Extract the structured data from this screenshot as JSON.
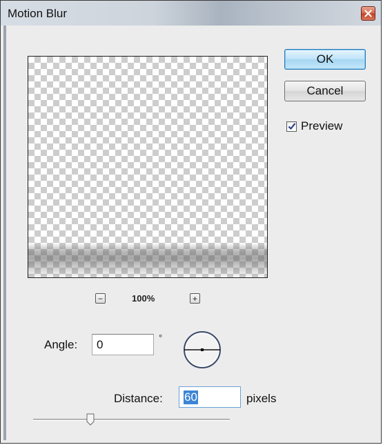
{
  "window": {
    "title": "Motion Blur"
  },
  "buttons": {
    "ok_label": "OK",
    "cancel_label": "Cancel"
  },
  "preview": {
    "checkbox_label": "Preview",
    "checked": true
  },
  "zoom": {
    "level": "100%",
    "zoom_out_symbol": "−",
    "zoom_in_symbol": "+"
  },
  "angle": {
    "label": "Angle:",
    "value": "0",
    "unit_symbol": "°"
  },
  "distance": {
    "label": "Distance:",
    "value": "60",
    "unit_label": "pixels"
  },
  "icons": {
    "close": "close-x-icon",
    "check": "checkmark-icon",
    "dial": "angle-dial-icon",
    "slider": "slider-thumb-icon"
  }
}
